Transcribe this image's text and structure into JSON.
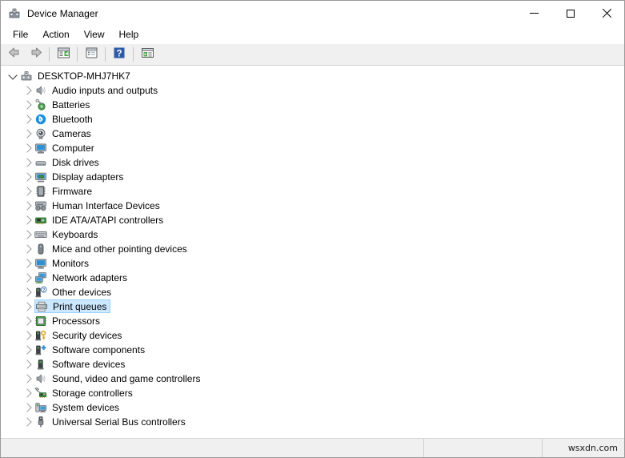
{
  "window": {
    "title": "Device Manager",
    "icon": "device-manager-icon",
    "controls": {
      "minimize": "minimize-button",
      "maximize": "maximize-button",
      "close": "close-button"
    }
  },
  "menubar": {
    "items": [
      {
        "label": "File"
      },
      {
        "label": "Action"
      },
      {
        "label": "View"
      },
      {
        "label": "Help"
      }
    ]
  },
  "toolbar": {
    "buttons": [
      {
        "name": "back-button",
        "icon": "arrow-left-icon"
      },
      {
        "name": "forward-button",
        "icon": "arrow-right-icon"
      },
      {
        "name": "properties-button",
        "icon": "properties-window-icon"
      },
      {
        "name": "show-hidden-devices-button",
        "icon": "list-window-icon"
      },
      {
        "name": "help-button",
        "icon": "question-mark-icon"
      },
      {
        "name": "scan-hardware-changes-button",
        "icon": "scan-window-icon"
      }
    ]
  },
  "tree": {
    "root": {
      "label": "DESKTOP-MHJ7HK7",
      "icon": "computer-node-icon",
      "expanded": true
    },
    "nodes": [
      {
        "label": "Audio inputs and outputs",
        "icon": "speaker-icon",
        "selected": false
      },
      {
        "label": "Batteries",
        "icon": "battery-icon",
        "selected": false
      },
      {
        "label": "Bluetooth",
        "icon": "bluetooth-icon",
        "selected": false
      },
      {
        "label": "Cameras",
        "icon": "camera-icon",
        "selected": false
      },
      {
        "label": "Computer",
        "icon": "monitor-icon",
        "selected": false
      },
      {
        "label": "Disk drives",
        "icon": "disk-drive-icon",
        "selected": false
      },
      {
        "label": "Display adapters",
        "icon": "display-adapter-icon",
        "selected": false
      },
      {
        "label": "Firmware",
        "icon": "firmware-chip-icon",
        "selected": false
      },
      {
        "label": "Human Interface Devices",
        "icon": "hid-gamepad-icon",
        "selected": false
      },
      {
        "label": "IDE ATA/ATAPI controllers",
        "icon": "ide-controller-icon",
        "selected": false
      },
      {
        "label": "Keyboards",
        "icon": "keyboard-icon",
        "selected": false
      },
      {
        "label": "Mice and other pointing devices",
        "icon": "mouse-icon",
        "selected": false
      },
      {
        "label": "Monitors",
        "icon": "monitor-icon",
        "selected": false
      },
      {
        "label": "Network adapters",
        "icon": "network-adapter-icon",
        "selected": false
      },
      {
        "label": "Other devices",
        "icon": "other-device-question-icon",
        "selected": false
      },
      {
        "label": "Print queues",
        "icon": "printer-icon",
        "selected": true
      },
      {
        "label": "Processors",
        "icon": "processor-icon",
        "selected": false
      },
      {
        "label": "Security devices",
        "icon": "security-key-icon",
        "selected": false
      },
      {
        "label": "Software components",
        "icon": "software-component-icon",
        "selected": false
      },
      {
        "label": "Software devices",
        "icon": "software-device-icon",
        "selected": false
      },
      {
        "label": "Sound, video and game controllers",
        "icon": "speaker-icon",
        "selected": false
      },
      {
        "label": "Storage controllers",
        "icon": "storage-controller-icon",
        "selected": false
      },
      {
        "label": "System devices",
        "icon": "system-device-icon",
        "selected": false
      },
      {
        "label": "Universal Serial Bus controllers",
        "icon": "usb-icon",
        "selected": false
      }
    ]
  },
  "statusbar": {
    "left": "",
    "middle": "",
    "right": "wsxdn.com"
  },
  "colors": {
    "selection_fill": "#cce8ff",
    "selection_border": "#99d1ff",
    "toolbar_bg": "#f0f0f0",
    "statusbar_bg": "#f0f0f0",
    "window_border": "#9a9a9a"
  }
}
